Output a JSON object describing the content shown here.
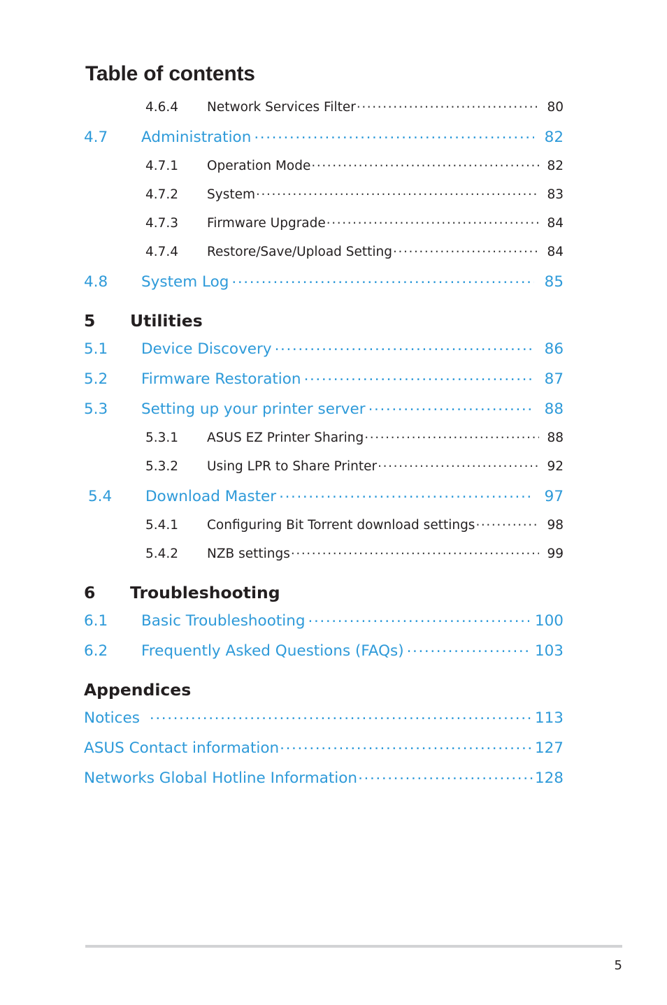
{
  "page": {
    "title": "Table of contents",
    "footer_page_number": "5",
    "link_color": "#2e9ad9",
    "text_color": "#231f20",
    "rule_color": "#d2d3d5"
  },
  "entries": [
    {
      "kind": "level2",
      "number": "4.6.4",
      "title": "Network Services Filter",
      "page": "80"
    },
    {
      "kind": "level1",
      "number": "4.7",
      "title": "Administration",
      "page": "82"
    },
    {
      "kind": "level2",
      "number": "4.7.1",
      "title": "Operation Mode",
      "page": "82"
    },
    {
      "kind": "level2",
      "number": "4.7.2",
      "title": "System",
      "page": "83"
    },
    {
      "kind": "level2",
      "number": "4.7.3",
      "title": "Firmware Upgrade",
      "page": "84"
    },
    {
      "kind": "level2",
      "number": "4.7.4",
      "title": "Restore/Save/Upload Setting",
      "page": "84"
    },
    {
      "kind": "level1",
      "number": "4.8",
      "title": "System Log",
      "page": "85"
    },
    {
      "kind": "chapter",
      "number": "5",
      "title": "Utilities"
    },
    {
      "kind": "level1",
      "number": "5.1",
      "title": "Device Discovery",
      "page": "86"
    },
    {
      "kind": "level1",
      "number": "5.2",
      "title": "Firmware Restoration",
      "page": "87"
    },
    {
      "kind": "level1",
      "number": "5.3",
      "title": "Setting up your printer server",
      "page": "88"
    },
    {
      "kind": "level2",
      "number": "5.3.1",
      "title": "ASUS EZ Printer Sharing",
      "page": "88"
    },
    {
      "kind": "level2",
      "number": "5.3.2",
      "title": "Using LPR to Share Printer",
      "page": "92"
    },
    {
      "kind": "level1",
      "number": "5.4",
      "title": "Download Master",
      "page": "97"
    },
    {
      "kind": "level2",
      "number": "5.4.1",
      "title": "Configuring Bit Torrent download settings",
      "page": "98"
    },
    {
      "kind": "level2",
      "number": "5.4.2",
      "title": "NZB settings",
      "page": "99"
    },
    {
      "kind": "chapter",
      "number": "6",
      "title": "Troubleshooting"
    },
    {
      "kind": "level1",
      "number": "6.1",
      "title": "Basic Troubleshooting",
      "page": "100"
    },
    {
      "kind": "level1",
      "number": "6.2",
      "title": "Frequently Asked Questions (FAQs)",
      "page": "103"
    },
    {
      "kind": "appendix-heading",
      "title": "Appendices"
    },
    {
      "kind": "appendix",
      "title": "Notices",
      "page": "113"
    },
    {
      "kind": "appendix",
      "title": "ASUS Contact information",
      "page": "127"
    },
    {
      "kind": "appendix",
      "title": "Networks Global Hotline Information",
      "page": "128"
    }
  ]
}
